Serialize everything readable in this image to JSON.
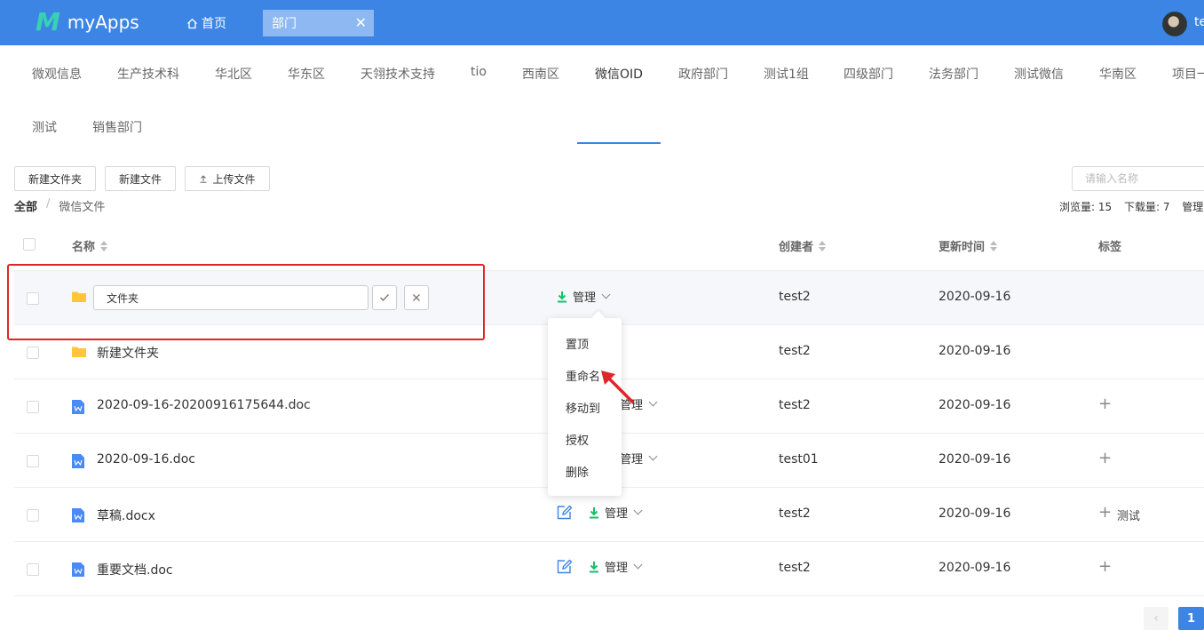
{
  "header": {
    "logo_mark": "M",
    "brand": "myApps",
    "home_label": "首页",
    "open_tab": "部门",
    "close_glyph": "✕",
    "user_name": "te"
  },
  "dept_tabs": {
    "row1": [
      "微观信息",
      "生产技术科",
      "华北区",
      "华东区",
      "天翎技术支持",
      "tio",
      "西南区",
      "微信OID",
      "政府部门",
      "测试1组",
      "四级部门",
      "法务部门",
      "测试微信",
      "华南区",
      "项目一"
    ],
    "row2": [
      "测试",
      "销售部门"
    ],
    "active": "微信OID"
  },
  "toolbar": {
    "new_folder": "新建文件夹",
    "new_file": "新建文件",
    "upload": "上传文件",
    "search_placeholder": "请输入名称"
  },
  "breadcrumb": {
    "root": "全部",
    "sep": "/",
    "current": "微信文件"
  },
  "stats": {
    "views": "浏览量: 15",
    "downloads": "下载量: 7",
    "manage": "管理"
  },
  "table": {
    "headers": {
      "name": "名称",
      "creator": "创建者",
      "updated": "更新时间",
      "tags": "标签"
    },
    "rename_value": "文件夹",
    "manage_label": "管理",
    "rows": [
      {
        "type": "folder",
        "name": "文件夹",
        "creator": "test2",
        "updated": "2020-09-16",
        "tag": ""
      },
      {
        "type": "folder",
        "name": "新建文件夹",
        "creator": "test2",
        "updated": "2020-09-16",
        "tag": ""
      },
      {
        "type": "doc",
        "name": "2020-09-16-20200916175644.doc",
        "creator": "test2",
        "updated": "2020-09-16",
        "tag": ""
      },
      {
        "type": "doc",
        "name": "2020-09-16.doc",
        "creator": "test01",
        "updated": "2020-09-16",
        "tag": ""
      },
      {
        "type": "doc",
        "name": "草稿.docx",
        "creator": "test2",
        "updated": "2020-09-16",
        "tag": "测试"
      },
      {
        "type": "doc",
        "name": "重要文档.doc",
        "creator": "test2",
        "updated": "2020-09-16",
        "tag": ""
      }
    ],
    "add_tag_glyph": "+"
  },
  "menu": {
    "items": [
      "置顶",
      "重命名",
      "移动到",
      "授权",
      "删除"
    ]
  },
  "pagination": {
    "prev": "‹",
    "current": "1"
  },
  "colors": {
    "primary": "#3d85e5",
    "download": "#19be6b",
    "folder": "#ffc53d",
    "doc": "#4a8af4",
    "highlight": "#e0252a"
  }
}
